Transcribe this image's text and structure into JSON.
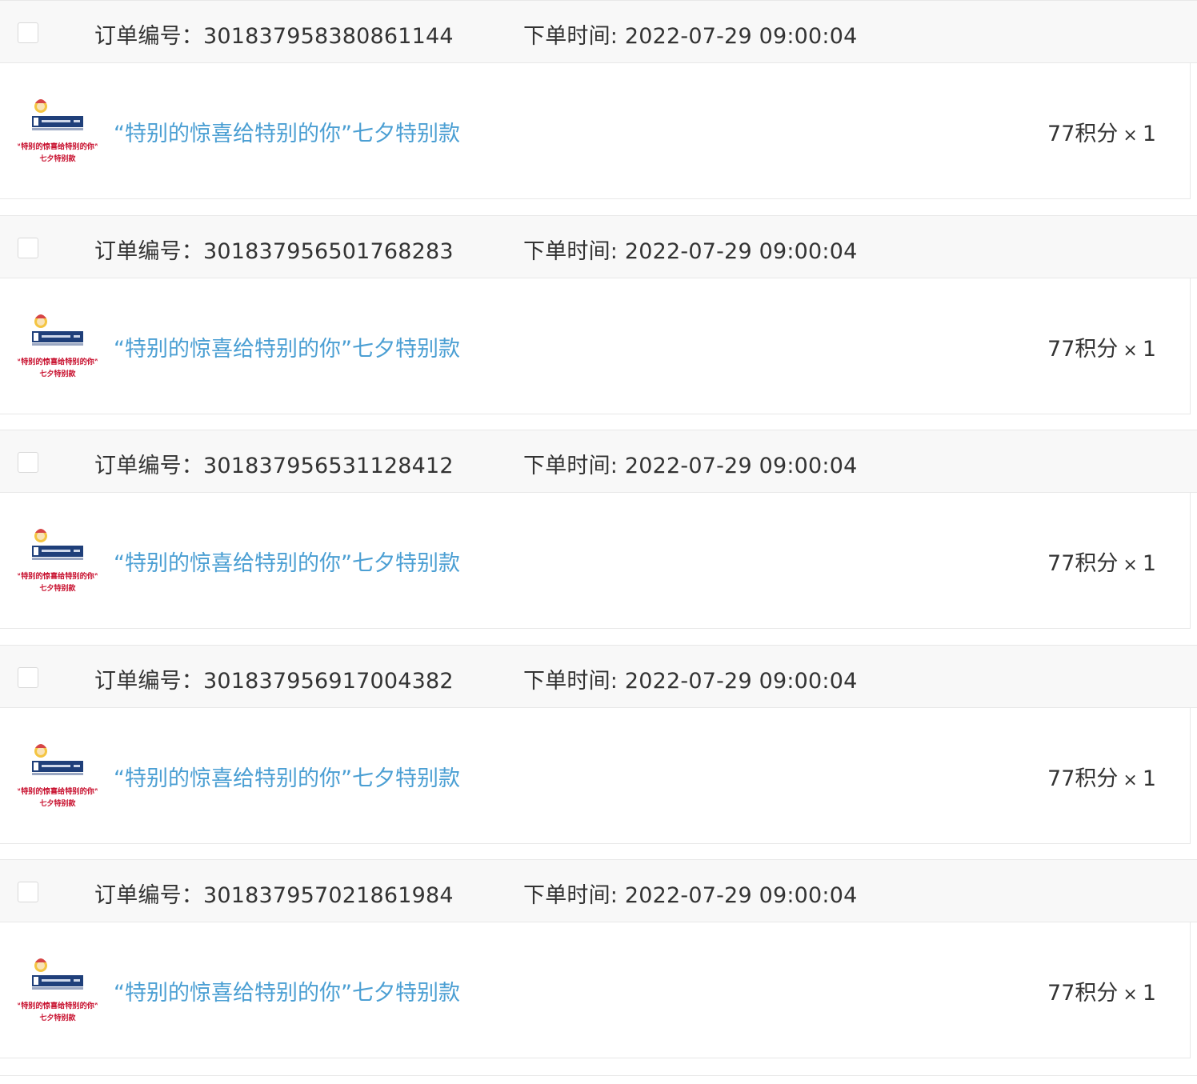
{
  "orders": [
    {
      "order_no_label": "订单编号：",
      "order_no": "301837958380861144",
      "time_label": "下单时间:",
      "time": "2022-07-29 09:00:04",
      "product": {
        "title": "“特别的惊喜给特别的你”七夕特别款",
        "thumb_caption_1": "“特别的惊喜给特别的你”",
        "thumb_caption_2": "七夕特别款"
      },
      "price": "77积分",
      "multiplier": "×",
      "qty": "1"
    },
    {
      "order_no_label": "订单编号：",
      "order_no": "301837956501768283",
      "time_label": "下单时间:",
      "time": "2022-07-29 09:00:04",
      "product": {
        "title": "“特别的惊喜给特别的你”七夕特别款",
        "thumb_caption_1": "“特别的惊喜给特别的你”",
        "thumb_caption_2": "七夕特别款"
      },
      "price": "77积分",
      "multiplier": "×",
      "qty": "1"
    },
    {
      "order_no_label": "订单编号：",
      "order_no": "301837956531128412",
      "time_label": "下单时间:",
      "time": "2022-07-29 09:00:04",
      "product": {
        "title": "“特别的惊喜给特别的你”七夕特别款",
        "thumb_caption_1": "“特别的惊喜给特别的你”",
        "thumb_caption_2": "七夕特别款"
      },
      "price": "77积分",
      "multiplier": "×",
      "qty": "1"
    },
    {
      "order_no_label": "订单编号：",
      "order_no": "301837956917004382",
      "time_label": "下单时间:",
      "time": "2022-07-29 09:00:04",
      "product": {
        "title": "“特别的惊喜给特别的你”七夕特别款",
        "thumb_caption_1": "“特别的惊喜给特别的你”",
        "thumb_caption_2": "七夕特别款"
      },
      "price": "77积分",
      "multiplier": "×",
      "qty": "1"
    },
    {
      "order_no_label": "订单编号：",
      "order_no": "301837957021861984",
      "time_label": "下单时间:",
      "time": "2022-07-29 09:00:04",
      "product": {
        "title": "“特别的惊喜给特别的你”七夕特别款",
        "thumb_caption_1": "“特别的惊喜给特别的你”",
        "thumb_caption_2": "七夕特别款"
      },
      "price": "77积分",
      "multiplier": "×",
      "qty": "1"
    }
  ],
  "colors": {
    "header_bg": "#f8f8f8",
    "border": "#e8e8e8",
    "link": "#4b9fd3",
    "text": "#333333",
    "thumb_red": "#c8102e",
    "thumb_blue": "#1f3f7a"
  }
}
